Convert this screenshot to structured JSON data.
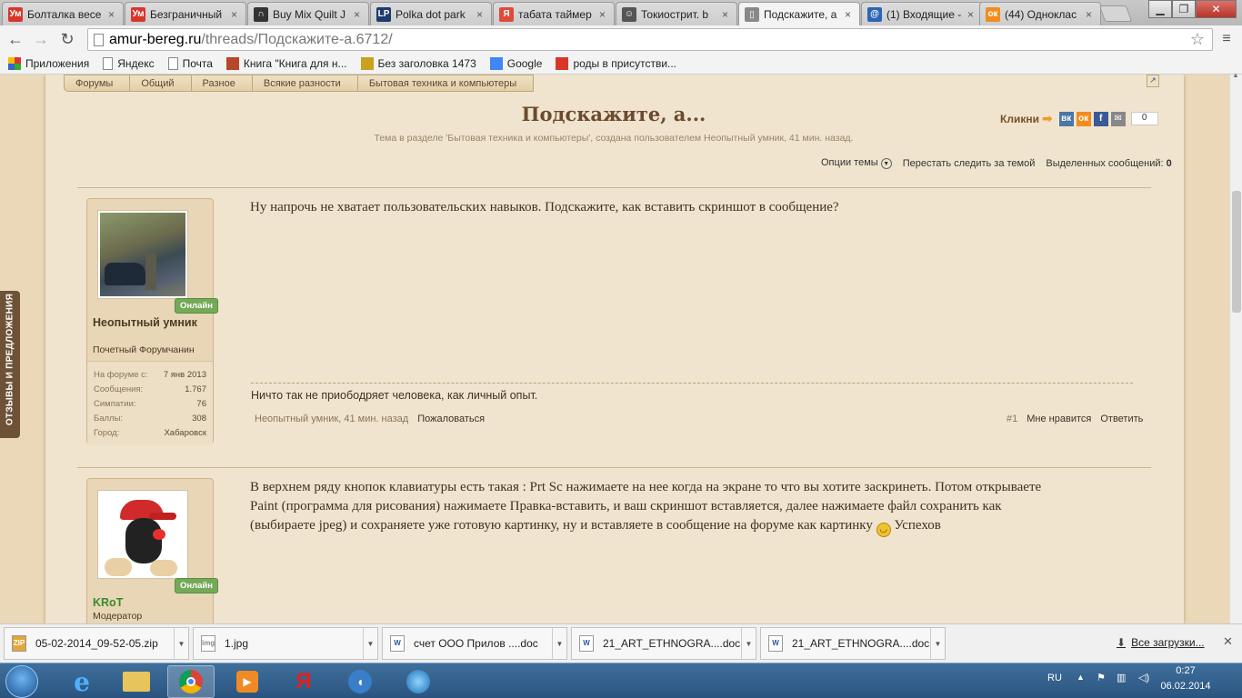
{
  "browser": {
    "tabs": [
      {
        "title": "Болталка весе",
        "icon": "Ум",
        "color": "#d9362b"
      },
      {
        "title": "Безграничный",
        "icon": "Ум",
        "color": "#d9362b"
      },
      {
        "title": "Buy Mix Quilt J",
        "icon": "∩",
        "color": "#333333"
      },
      {
        "title": "Polka dot park",
        "icon": "LP",
        "color": "#1e3b6e"
      },
      {
        "title": "табата таймер",
        "icon": "Я",
        "color": "#e04a3a"
      },
      {
        "title": "Токиострит. b",
        "icon": "☺",
        "color": "#555555"
      },
      {
        "title": "Подскажите, а",
        "icon": "▯",
        "color": "#888888"
      },
      {
        "title": "(1) Входящие -",
        "icon": "@",
        "color": "#2b66b5"
      },
      {
        "title": "(44) Одноклас",
        "icon": "ок",
        "color": "#f28c1e"
      }
    ],
    "active_tab_index": 6,
    "url_domain": "amur-bereg.ru",
    "url_path": "/threads/Подскажите-а.6712/",
    "bookmarks": [
      {
        "label": "Приложения",
        "icon": "apps-icon"
      },
      {
        "label": "Яндекс",
        "icon": "page-icon"
      },
      {
        "label": "Почта",
        "icon": "page-icon"
      },
      {
        "label": "Книга \"Книга для н...",
        "icon": "book-icon"
      },
      {
        "label": "Без заголовка 1473",
        "icon": "pin-icon"
      },
      {
        "label": "Google",
        "icon": "google-icon"
      },
      {
        "label": "роды в присутстви...",
        "icon": "ym-icon"
      }
    ]
  },
  "forum": {
    "breadcrumbs": [
      "Форумы",
      "Общий",
      "Разное",
      "Всякие разности",
      "Бытовая техника и компьютеры"
    ],
    "title": "Подскажите, а...",
    "subtitle": "Тема в разделе 'Бытовая техника и компьютеры', создана пользователем Неопытный умник, 41 мин. назад.",
    "share_label": "Кликни",
    "share_count": "0",
    "thread_options": "Опции темы",
    "unwatch": "Перестать следить за темой",
    "selected_label": "Выделенных сообщений:",
    "selected_count": "0",
    "feedback_tab": "ОТЗЫВЫ И ПРЕДЛОЖЕНИЯ"
  },
  "posts": [
    {
      "author": "Неопытный умник",
      "role": "Почетный Форумчанин",
      "online": "Онлайн",
      "stats": [
        {
          "k": "На форуме с:",
          "v": "7 янв 2013"
        },
        {
          "k": "Сообщения:",
          "v": "1.767"
        },
        {
          "k": "Симпатии:",
          "v": "76"
        },
        {
          "k": "Баллы:",
          "v": "308"
        },
        {
          "k": "Город:",
          "v": "Хабаровск"
        }
      ],
      "text": "Ну напрочь не хватает пользовательских навыков. Подскажите, как вставить скриншот в сообщение?",
      "signature": "Ничто так не приободряет человека, как личный опыт.",
      "meta_author_time": "Неопытный умник, 41 мин. назад",
      "report": "Пожаловаться",
      "number": "#1",
      "like": "Мне нравится",
      "reply": "Ответить"
    },
    {
      "author": "KRoT",
      "role": "Модератор",
      "online": "Онлайн",
      "text_line1": "В верхнем ряду кнопок клавиатуры есть такая : Prt Sc нажимаете на нее когда на экране то что вы хотите заскринеть. Потом открываете",
      "text_line2": "Paint (программа для рисования) нажимаете Правка-вставить, и ваш скриншот вставляется, далее нажимаете файл сохранить как",
      "text_line3": "(выбираете jpeg) и сохраняете уже готовую картинку, ну и вставляете в сообщение на форуме как картинку",
      "text_line3_end": "Успехов"
    }
  ],
  "downloads": {
    "items": [
      {
        "name": "05-02-2014_09-52-05.zip",
        "icon": "ZIP"
      },
      {
        "name": "1.jpg",
        "icon": "img"
      },
      {
        "name": "счет ООО Прилов ....doc",
        "icon": "W"
      },
      {
        "name": "21_ART_ETHNOGRA....doc",
        "icon": "W"
      },
      {
        "name": "21_ART_ETHNOGRA....doc",
        "icon": "W"
      }
    ],
    "all": "Все загрузки..."
  },
  "taskbar": {
    "lang": "RU",
    "time": "0:27",
    "date": "06.02.2014"
  }
}
